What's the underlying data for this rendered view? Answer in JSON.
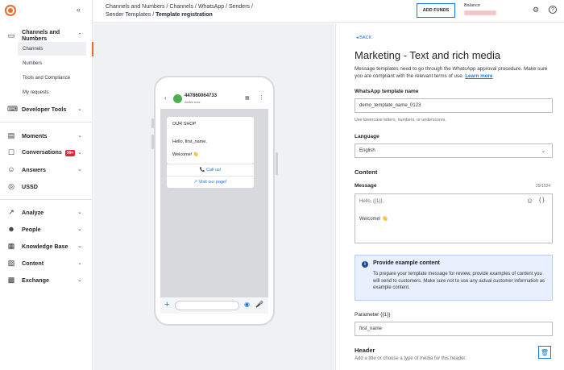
{
  "sidebar": {
    "collapse_glyph": "«",
    "items": [
      {
        "id": "channels",
        "label": "Channels and Numbers",
        "icon": "channels-icon",
        "glyph": "▭"
      },
      {
        "id": "developer",
        "label": "Developer Tools",
        "icon": "code-icon",
        "glyph": "⌨"
      },
      {
        "id": "moments",
        "label": "Moments",
        "icon": "moments-icon",
        "glyph": "▤"
      },
      {
        "id": "conversations",
        "label": "Conversations",
        "icon": "chat-icon",
        "glyph": "☐",
        "badge": "99+"
      },
      {
        "id": "answers",
        "label": "Answers",
        "icon": "bot-icon",
        "glyph": "☺"
      },
      {
        "id": "ussd",
        "label": "USSD",
        "icon": "ussd-icon",
        "glyph": "◎"
      },
      {
        "id": "analyze",
        "label": "Analyze",
        "icon": "chart-icon",
        "glyph": "↗"
      },
      {
        "id": "people",
        "label": "People",
        "icon": "people-icon",
        "glyph": "☻"
      },
      {
        "id": "knowledge",
        "label": "Knowledge Base",
        "icon": "book-icon",
        "glyph": "▦"
      },
      {
        "id": "content",
        "label": "Content",
        "icon": "content-icon",
        "glyph": "▧"
      },
      {
        "id": "exchange",
        "label": "Exchange",
        "icon": "exchange-icon",
        "glyph": "▩"
      }
    ],
    "sub_items": [
      "Channels",
      "Numbers",
      "Tools and Compliance",
      "My requests"
    ]
  },
  "header": {
    "breadcrumb": [
      "Channels and Numbers",
      "Channels",
      "WhatsApp",
      "Senders",
      "Sender Templates"
    ],
    "breadcrumb_current": "Template registration",
    "add_funds": "ADD FUNDS",
    "balance_label": "Balance",
    "icons": {
      "settings": "⚙",
      "help": "?"
    }
  },
  "preview": {
    "phone_number": "447860064733",
    "status": "Active now",
    "back_glyph": "‹",
    "more_glyph": "⋮",
    "calendar_glyph": "▦",
    "bubble": {
      "l1": "OUR SHOP",
      "l2": "Hello, first_name,",
      "l3": "Welcome! 👋"
    },
    "buttons": [
      "📞 Call us!",
      "↗ Visit our page!"
    ],
    "plus_glyph": "+",
    "camera_glyph": "◉",
    "mic_glyph": "🎤"
  },
  "form": {
    "back": "◂  BACK",
    "title": "Marketing - Text and rich media",
    "intro_text": "Message templates need to go through the WhatsApp approval procedure. Make sure you are compliant with the relevant terms of use.",
    "intro_link": "Learn more",
    "template_name_label": "WhatsApp template name",
    "template_name_value": "demo_template_name_0123",
    "template_name_hint": "Use lowercase letters, numbers, or underscores.",
    "language_label": "Language",
    "language_value": "English",
    "content_heading": "Content",
    "message_label": "Message",
    "message_counter": "29/1024",
    "message_line1": "Hello, {{1}},",
    "message_line2": "Welcome! 👋",
    "emoji_glyph": "☺",
    "variable_glyph": "{ }",
    "info_icon": "i",
    "info_title": "Provide example content",
    "info_text": "To prepare your template message for review, provide examples of content you will send to customers. Make sure not to use any actual customer information as example content.",
    "param_label": "Parameter {{1}}",
    "param_value": "first_name",
    "header_heading": "Header",
    "header_hint": "Add a title or choose a type of media for this header.",
    "trash_glyph": "🗑",
    "chevron_glyph": "⌄"
  }
}
